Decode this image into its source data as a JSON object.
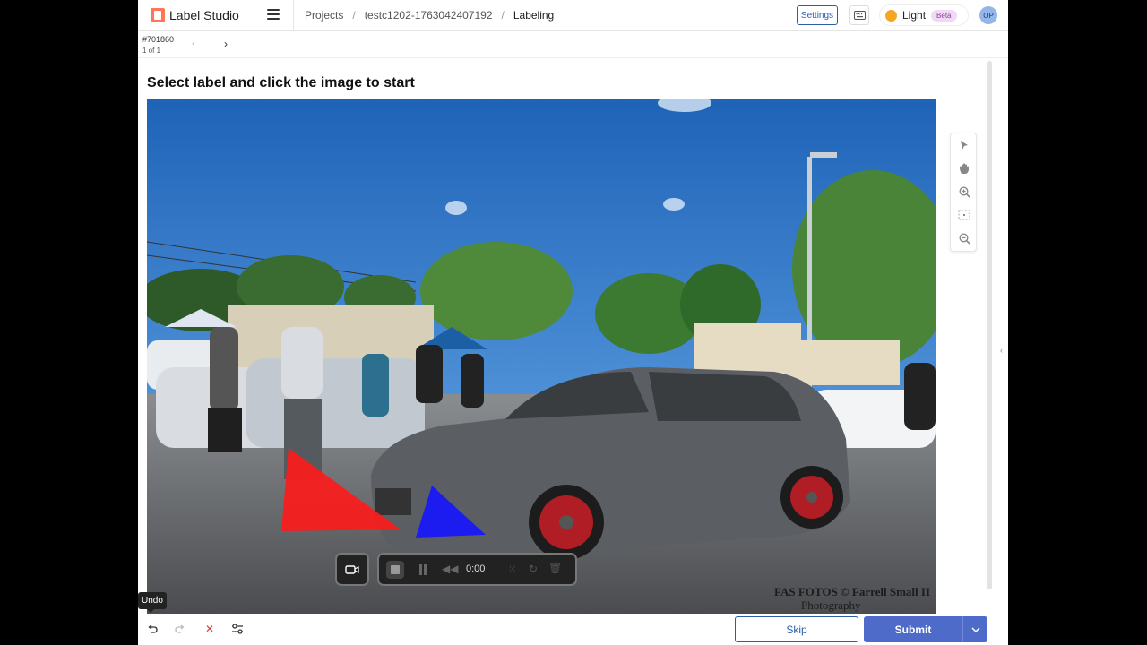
{
  "header": {
    "app_name": "Label Studio",
    "breadcrumbs": [
      "Projects",
      "testc1202-1763042407192",
      "Labeling"
    ],
    "separator": "/",
    "settings_label": "Settings",
    "theme_label": "Light",
    "theme_badge": "Beta",
    "avatar_initials": "OP"
  },
  "task": {
    "id": "#701860",
    "counter": "1 of 1"
  },
  "main": {
    "instruction": "Select label and click the image to start",
    "watermark_line1": "FAS FOTOS © Farrell Small II",
    "watermark_line2": "Photography"
  },
  "tools": [
    "select-icon",
    "pan-icon",
    "zoom-in-icon",
    "fit-icon",
    "zoom-out-icon"
  ],
  "recorder": {
    "time": "0:00"
  },
  "bottom": {
    "tooltip": "Undo",
    "skip_label": "Skip",
    "submit_label": "Submit"
  },
  "colors": {
    "accent": "#4f6bc9",
    "link": "#2b5ea8",
    "annotation_red": "#ff1a1a",
    "annotation_blue": "#1515ff"
  }
}
